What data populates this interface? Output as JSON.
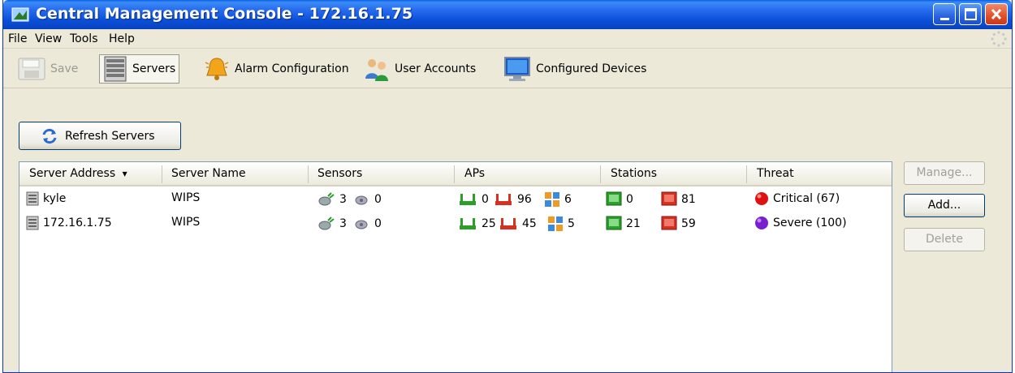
{
  "window": {
    "title": "Central Management Console - 172.16.1.75"
  },
  "menu": [
    {
      "label": "File"
    },
    {
      "label": "View"
    },
    {
      "label": "Tools"
    },
    {
      "label": "Help"
    }
  ],
  "toolbar": {
    "save_label": "Save",
    "servers_label": "Servers",
    "alarm_label": "Alarm Configuration",
    "users_label": "User Accounts",
    "devices_label": "Configured Devices"
  },
  "refresh_label": "Refresh Servers",
  "table": {
    "columns": [
      "Server Address",
      "Server Name",
      "Sensors",
      "APs",
      "Stations",
      "Threat"
    ],
    "sort_indicator": "▾",
    "rows": [
      {
        "address": "kyle",
        "name": "WIPS",
        "sensors_up": "3",
        "sensors_down": "0",
        "aps_green": "0",
        "aps_red": "96",
        "aps_other": "6",
        "stations_green": "0",
        "stations_red": "81",
        "threat": "Critical (67)",
        "threat_color": "#e01010"
      },
      {
        "address": "172.16.1.75",
        "name": "WIPS",
        "sensors_up": "3",
        "sensors_down": "0",
        "aps_green": "25",
        "aps_red": "45",
        "aps_other": "5",
        "stations_green": "21",
        "stations_red": "59",
        "threat": "Severe (100)",
        "threat_color": "#7a1fd0"
      }
    ]
  },
  "side_buttons": {
    "manage": "Manage...",
    "add": "Add...",
    "delete": "Delete"
  },
  "colors": {
    "titlebar": "#0a4fd8",
    "window_bg": "#ece9d8",
    "critical": "#e01010",
    "severe": "#7a1fd0"
  }
}
